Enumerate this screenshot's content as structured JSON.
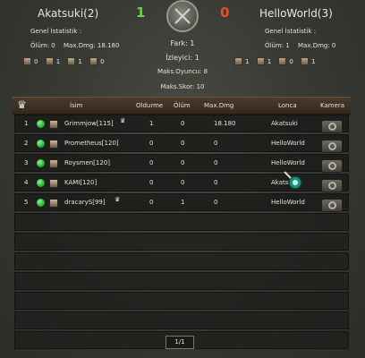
{
  "team_left": {
    "name": "Akatsuki(2)",
    "score": "1",
    "score_color": "#6fcf4a",
    "stats_title": "Genel İstatistik :",
    "deaths": "Ölüm: 0",
    "max_dmg": "Max.Dmg: 18.180",
    "classes": [
      {
        "icon": "warrior-class-icon",
        "count": "0"
      },
      {
        "icon": "ninja-class-icon",
        "count": "1"
      },
      {
        "icon": "sura-class-icon",
        "count": "1"
      },
      {
        "icon": "shaman-class-icon",
        "count": "0"
      }
    ]
  },
  "team_right": {
    "name": "HelloWorld(3)",
    "score": "0",
    "score_color": "#e8501f",
    "stats_title": "Genel İstatistik :",
    "deaths": "Ölüm: 1",
    "max_dmg": "Max.Dmg: 0",
    "classes": [
      {
        "icon": "warrior-class-icon",
        "count": "1"
      },
      {
        "icon": "ninja-class-icon",
        "count": "1"
      },
      {
        "icon": "sura-class-icon",
        "count": "0"
      },
      {
        "icon": "shaman-class-icon",
        "count": "1"
      }
    ]
  },
  "center": {
    "difference": "Fark: 1",
    "spectators": "İzleyici: 1",
    "max_players": "Maks.Oyuncu: 8",
    "max_score": "Maks.Skor: 10"
  },
  "table": {
    "headers": {
      "name": "İsim",
      "kills": "Oldurme",
      "deaths": "Ölüm",
      "max_dmg": "Max.Dmg",
      "guild": "Lonca",
      "camera": "Kamera"
    },
    "rows": [
      {
        "num": "1",
        "name": "Grimmjow[115]",
        "kills": "1",
        "deaths": "0",
        "max_dmg": "18.180",
        "guild": "Akatsuki",
        "crown": true
      },
      {
        "num": "2",
        "name": "Prometheus[120]",
        "kills": "0",
        "deaths": "0",
        "max_dmg": "0",
        "guild": "HelloWorld",
        "crown": false
      },
      {
        "num": "3",
        "name": "Roysmen[120]",
        "kills": "0",
        "deaths": "0",
        "max_dmg": "0",
        "guild": "HelloWorld",
        "crown": false
      },
      {
        "num": "4",
        "name": "KAMI[120]",
        "kills": "0",
        "deaths": "0",
        "max_dmg": "0",
        "guild": "Akatsuki",
        "crown": false
      },
      {
        "num": "5",
        "name": "dracaryS[99]",
        "kills": "0",
        "deaths": "1",
        "max_dmg": "0",
        "guild": "HelloWorld",
        "crown": true
      }
    ]
  },
  "pager": "1/1"
}
